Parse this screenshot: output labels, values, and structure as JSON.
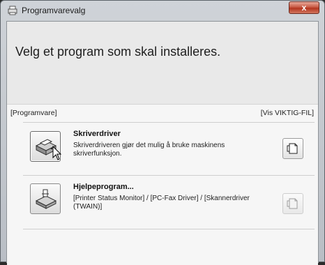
{
  "window": {
    "title": "Programvarevalg",
    "close_glyph": "x"
  },
  "heading": "Velg et program som skal installeres.",
  "section": {
    "software_label": "[Programvare]",
    "readme_link": "[Vis VIKTIG-FIL]"
  },
  "items": [
    {
      "title": "Skriverdriver",
      "desc_line1": "Skriverdriveren gjør det mulig å bruke maskinens",
      "desc_line2": "skriverfunksjon.",
      "icon": "printer-icon",
      "doc_icon": "document-icon"
    },
    {
      "title": "Hjelpeprogram...",
      "desc_line1": "[Printer Status Monitor] / [PC-Fax Driver] / [Skannerdriver",
      "desc_line2": "(TWAIN)]",
      "icon": "utility-icon",
      "doc_icon": "document-icon"
    }
  ]
}
